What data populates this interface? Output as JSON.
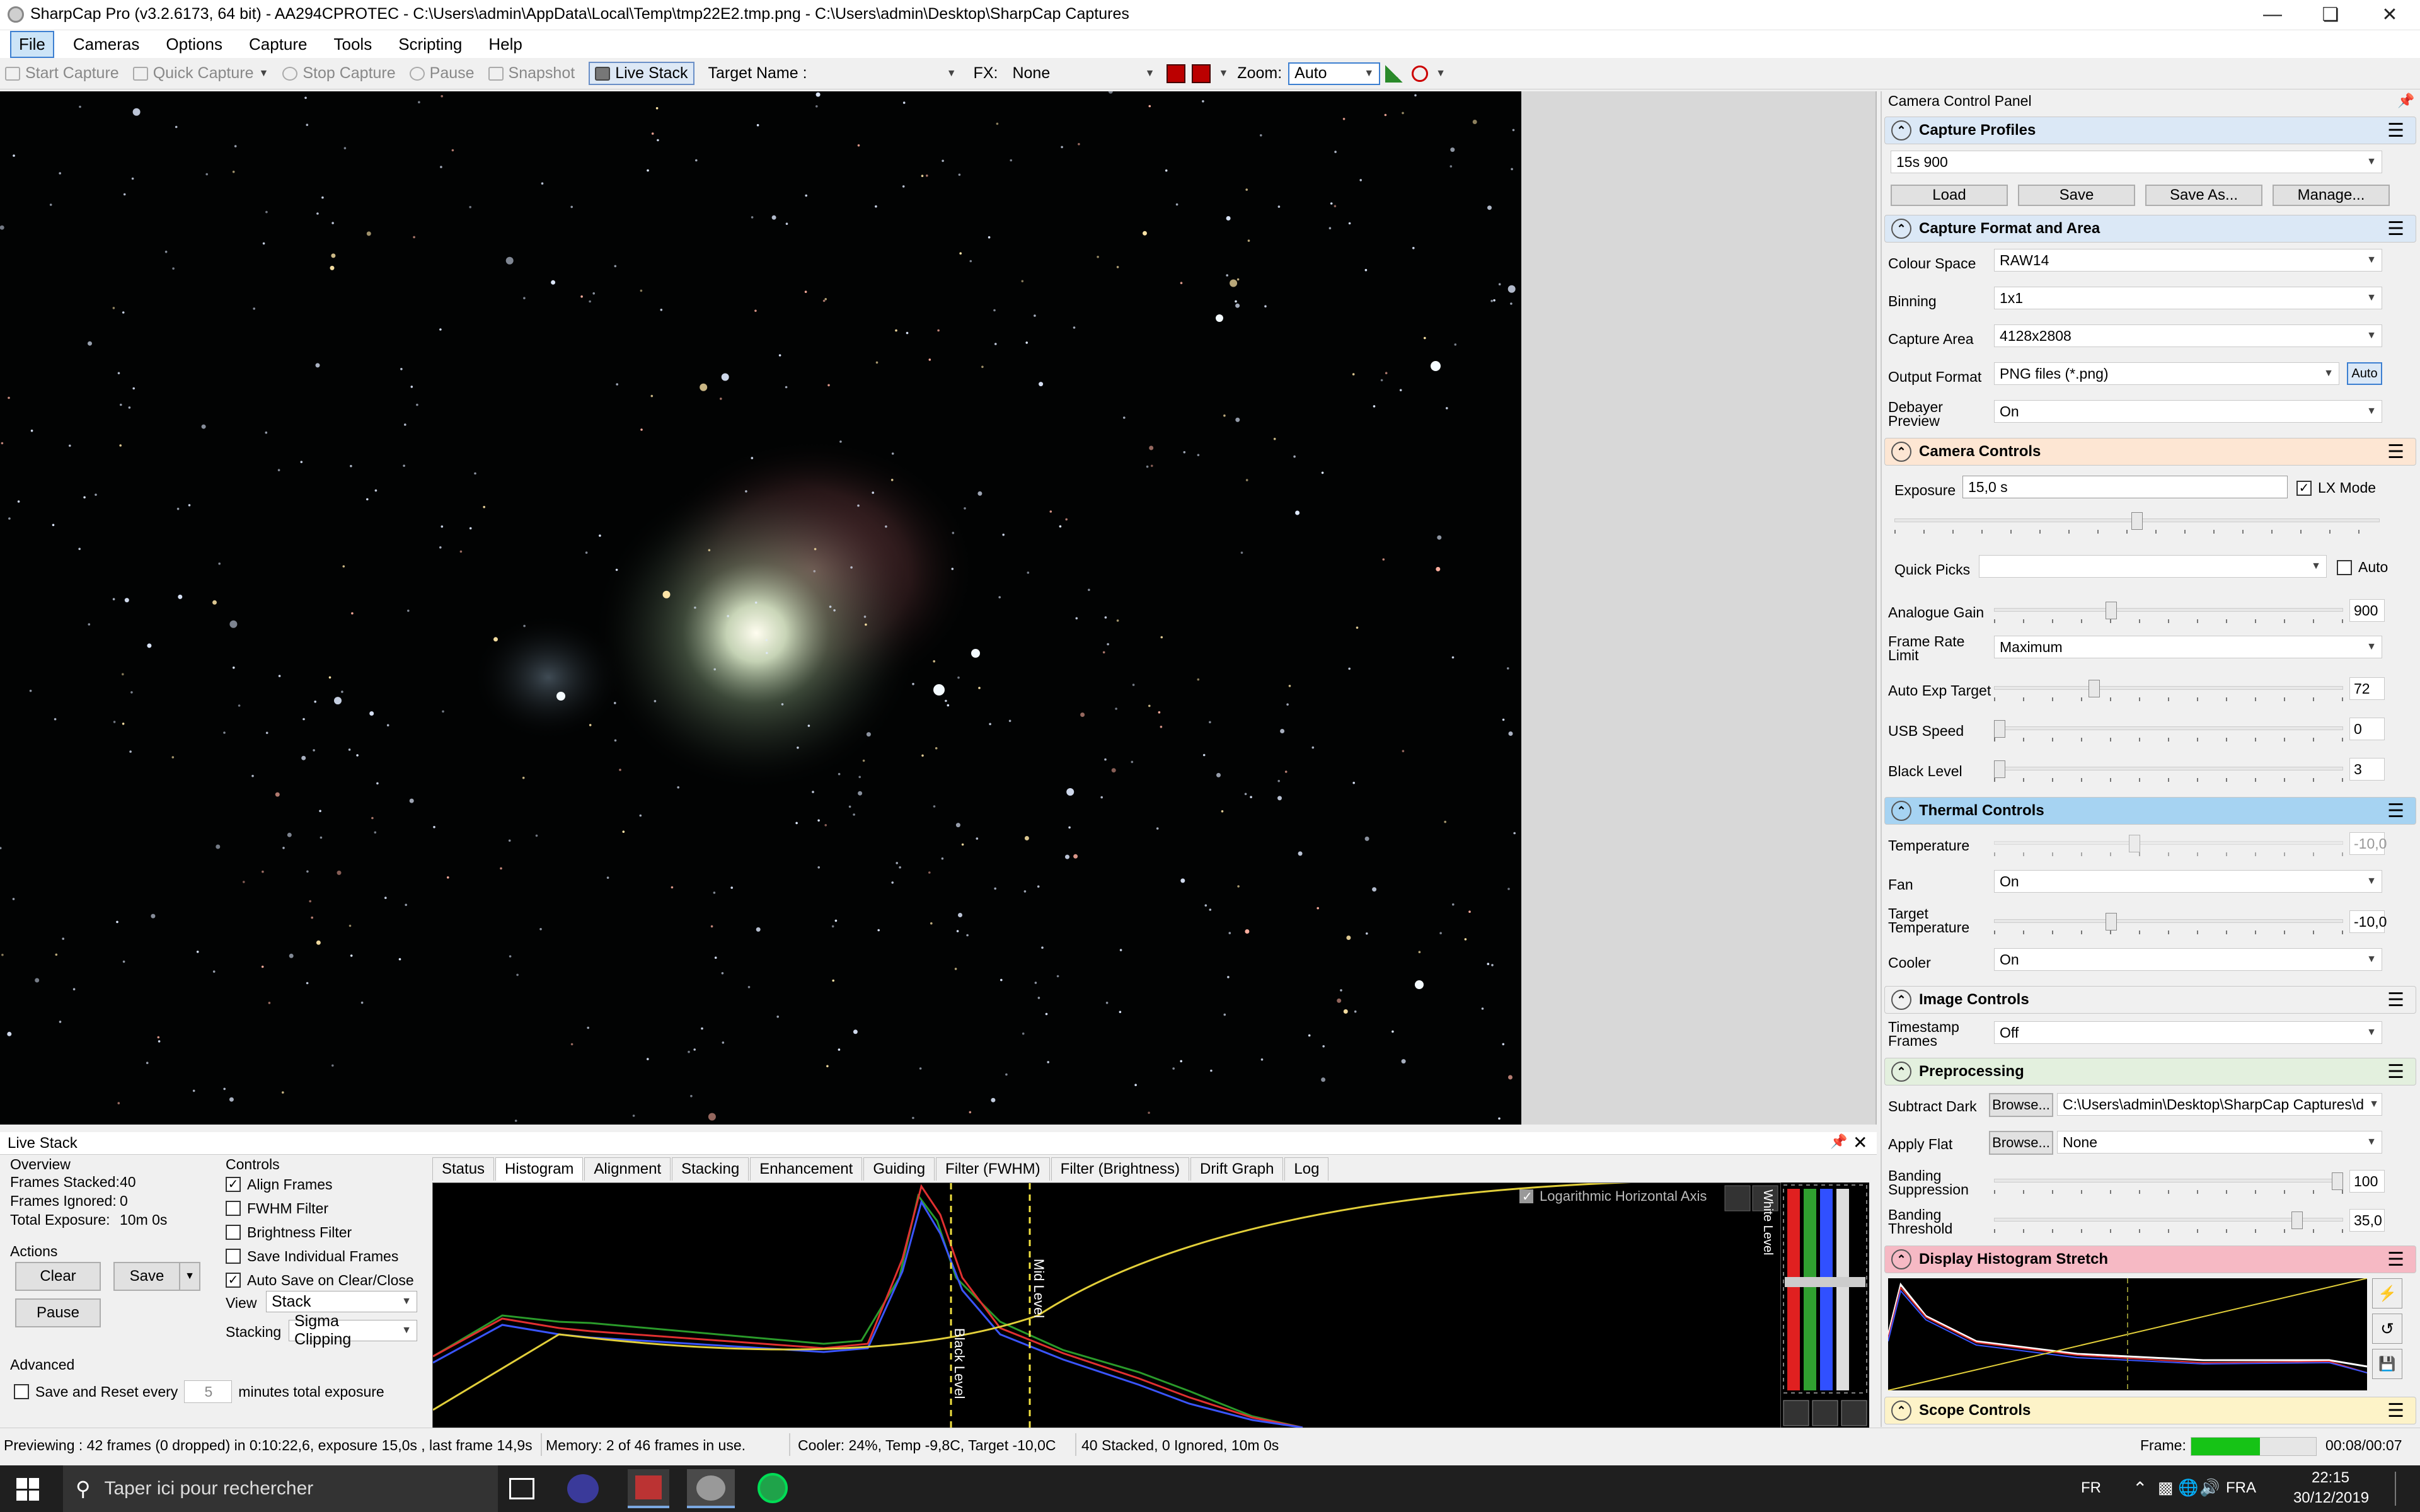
{
  "window": {
    "title": "SharpCap Pro (v3.2.6173, 64 bit) - AA294CPROTEC - C:\\Users\\admin\\AppData\\Local\\Temp\\tmp22E2.tmp.png - C:\\Users\\admin\\Desktop\\SharpCap Captures"
  },
  "menu": [
    "File",
    "Cameras",
    "Options",
    "Capture",
    "Tools",
    "Scripting",
    "Help"
  ],
  "toolbar": {
    "start_capture": "Start Capture",
    "quick_capture": "Quick Capture",
    "stop_capture": "Stop Capture",
    "pause": "Pause",
    "snapshot": "Snapshot",
    "live_stack": "Live Stack",
    "target_name_label": "Target Name :",
    "target_name_value": "",
    "fx_label": "FX:",
    "fx_value": "None",
    "zoom_label": "Zoom:",
    "zoom_value": "Auto"
  },
  "live_stack": {
    "title": "Live Stack",
    "overview": {
      "heading": "Overview",
      "frames_stacked_label": "Frames Stacked:",
      "frames_stacked": "40",
      "frames_ignored_label": "Frames Ignored:",
      "frames_ignored": "0",
      "total_exposure_label": "Total Exposure:",
      "total_exposure": "10m 0s"
    },
    "actions": {
      "heading": "Actions",
      "clear": "Clear",
      "save": "Save",
      "pause": "Pause"
    },
    "advanced": {
      "heading": "Advanced",
      "save_reset_label": "Save and Reset every",
      "save_reset_value": "5",
      "minutes_label": "minutes total exposure"
    },
    "controls": {
      "heading": "Controls",
      "items": [
        {
          "label": "Align Frames",
          "checked": true
        },
        {
          "label": "FWHM Filter",
          "checked": false
        },
        {
          "label": "Brightness Filter",
          "checked": false
        },
        {
          "label": "Save Individual Frames",
          "checked": false
        },
        {
          "label": "Auto Save on Clear/Close",
          "checked": true
        }
      ],
      "view_label": "View",
      "view_value": "Stack",
      "stacking_label": "Stacking",
      "stacking_value": "Sigma Clipping"
    },
    "tabs": [
      "Status",
      "Histogram",
      "Alignment",
      "Stacking",
      "Enhancement",
      "Guiding",
      "Filter (FWHM)",
      "Filter (Brightness)",
      "Drift Graph",
      "Log"
    ],
    "active_tab": "Histogram",
    "histogram": {
      "log_axis_label": "Logarithmic Horizontal Axis",
      "black_level_label": "Black Level",
      "mid_level_label": "Mid Level",
      "white_level_label": "White Level"
    }
  },
  "camera_panel": {
    "title": "Camera Control Panel",
    "capture_profiles": {
      "heading": "Capture Profiles",
      "value": "15s 900",
      "load": "Load",
      "save": "Save",
      "save_as": "Save As...",
      "manage": "Manage..."
    },
    "format": {
      "heading": "Capture Format and Area",
      "colour_space_label": "Colour Space",
      "colour_space": "RAW14",
      "binning_label": "Binning",
      "binning": "1x1",
      "capture_area_label": "Capture Area",
      "capture_area": "4128x2808",
      "output_format_label": "Output Format",
      "output_format": "PNG files (*.png)",
      "auto": "Auto",
      "debayer_label_1": "Debayer",
      "debayer_label_2": "Preview",
      "debayer": "On"
    },
    "camera_controls": {
      "heading": "Camera Controls",
      "exposure_label": "Exposure",
      "exposure": "15,0 s",
      "lx_mode": "LX Mode",
      "quick_picks_label": "Quick Picks",
      "quick_picks_auto": "Auto",
      "gain_label": "Analogue Gain",
      "gain": "900",
      "frame_rate_label_1": "Frame Rate",
      "frame_rate_label_2": "Limit",
      "frame_rate": "Maximum",
      "auto_exp_label": "Auto Exp Target",
      "auto_exp": "72",
      "usb_label": "USB Speed",
      "usb": "0",
      "black_label": "Black Level",
      "black": "3",
      "exposure_slider": 0.5,
      "gain_slider": 0.33,
      "auto_exp_slider": 0.28,
      "usb_slider": 0.0,
      "black_slider": 0.0
    },
    "thermal": {
      "heading": "Thermal Controls",
      "temperature_label": "Temperature",
      "temperature": "-10,0",
      "fan_label": "Fan",
      "fan": "On",
      "target_temp_label_1": "Target",
      "target_temp_label_2": "Temperature",
      "target_temp": "-10,0",
      "cooler_label": "Cooler",
      "cooler": "On",
      "temperature_slider": 0.4,
      "target_slider": 0.33
    },
    "image_controls": {
      "heading": "Image Controls",
      "timestamp_label_1": "Timestamp",
      "timestamp_label_2": "Frames",
      "timestamp": "Off"
    },
    "preprocessing": {
      "heading": "Preprocessing",
      "subtract_dark_label": "Subtract Dark",
      "browse": "Browse...",
      "subtract_dark": "C:\\Users\\admin\\Desktop\\SharpCap Captures\\d",
      "apply_flat_label": "Apply Flat",
      "apply_flat": "None",
      "banding_supp_label_1": "Banding",
      "banding_supp_label_2": "Suppression",
      "banding_supp": "100",
      "banding_thresh_label_1": "Banding",
      "banding_thresh_label_2": "Threshold",
      "banding_thresh": "35,0",
      "banding_supp_slider": 1.0,
      "banding_thresh_slider": 0.88
    },
    "display_histogram": {
      "heading": "Display Histogram Stretch"
    },
    "scope": {
      "heading": "Scope Controls"
    }
  },
  "status": {
    "previewing": "Previewing : 42 frames (0 dropped) in 0:10:22,6, exposure 15,0s , last frame 14,9s",
    "memory": "Memory: 2 of 46 frames in use.",
    "cooler": "Cooler: 24%, Temp -9,8C, Target -10,0C",
    "stacked": "40 Stacked, 0 Ignored, 10m 0s",
    "frame_label": "Frame:",
    "frame_time": "00:08/00:07",
    "frame_progress": 0.55
  },
  "taskbar": {
    "search_placeholder": "Taper ici pour rechercher",
    "lang_fr": "FR",
    "lang_fra": "FRA",
    "time": "22:15",
    "date": "30/12/2019"
  },
  "colors": {
    "accent": "#3c7fd1",
    "capture_profiles": "#dbe8f6",
    "camera_controls": "#fde6d3",
    "thermal": "#a6d3f2",
    "image_controls": "#f0f0f0",
    "preprocessing": "#e3f0de",
    "display_histogram": "#f6b9c4",
    "scope": "#fdf3c8",
    "progress": "#16c316"
  }
}
